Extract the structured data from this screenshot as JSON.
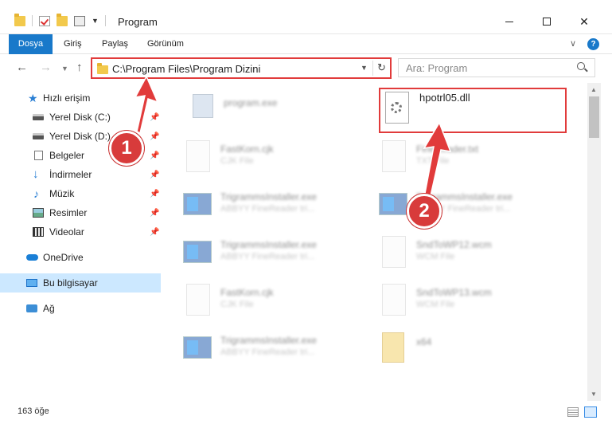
{
  "window": {
    "title": "Program"
  },
  "ribbon": {
    "tabs": [
      "Dosya",
      "Giriş",
      "Paylaş",
      "Görünüm"
    ]
  },
  "help": {
    "label": "?"
  },
  "address": {
    "path": "C:\\Program Files\\Program Dizini"
  },
  "search": {
    "placeholder": "Ara: Program"
  },
  "sidebar": {
    "quick_access": "Hızlı erişim",
    "items": [
      "Yerel Disk (C:)",
      "Yerel Disk (D:)",
      "Belgeler",
      "İndirmeler",
      "Müzik",
      "Resimler",
      "Videolar"
    ],
    "onedrive": "OneDrive",
    "this_pc": "Bu bilgisayar",
    "network": "Ağ"
  },
  "files": [
    {
      "name": "program.exe",
      "sub": ""
    },
    {
      "name": "hpotrl05.dll",
      "sub": ""
    },
    {
      "name": "FastKorn.cjk",
      "sub": "CJK File"
    },
    {
      "name": "FineReader.txt",
      "sub": "TXT File"
    },
    {
      "name": "TrigrammsInstaller.exe",
      "sub": "ABBYY FineReader tri..."
    },
    {
      "name": "TrigrammsInstaller.exe",
      "sub": "ABBYY FineReader tri..."
    },
    {
      "name": "TrigrammsInstaller.exe",
      "sub": "ABBYY FineReader tri..."
    },
    {
      "name": "SndToWP12.wcm",
      "sub": "WCM File"
    },
    {
      "name": "FastKorn.cjk",
      "sub": "CJK File"
    },
    {
      "name": "SndToWP13.wcm",
      "sub": "WCM File"
    },
    {
      "name": "TrigrammsInstaller.exe",
      "sub": "ABBYY FineReader tri..."
    },
    {
      "name": "x64",
      "sub": ""
    }
  ],
  "status": {
    "count": "163 öğe"
  },
  "annotations": {
    "step1": "1",
    "step2": "2"
  },
  "colors": {
    "accent": "#1979ca",
    "annotation": "#e13b3b",
    "selection": "#cce8ff"
  }
}
